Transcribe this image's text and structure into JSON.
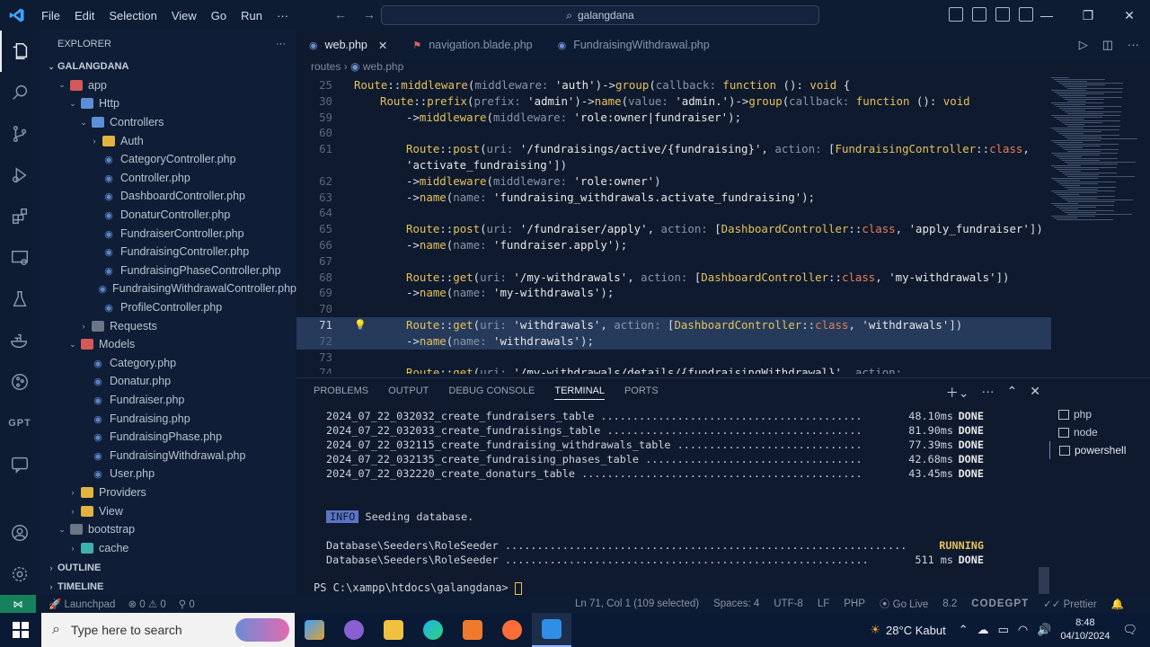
{
  "titlebar": {
    "menu": [
      "File",
      "Edit",
      "Selection",
      "View",
      "Go",
      "Run",
      "···"
    ],
    "search": "galangdana"
  },
  "explorer": {
    "title": "EXPLORER",
    "root": "GALANGDANA",
    "tree": [
      {
        "label": "app",
        "depth": 1,
        "open": true,
        "type": "folder-red"
      },
      {
        "label": "Http",
        "depth": 2,
        "open": true,
        "type": "folder"
      },
      {
        "label": "Controllers",
        "depth": 3,
        "open": true,
        "type": "folder"
      },
      {
        "label": "Auth",
        "depth": 4,
        "open": false,
        "type": "folder-yellow"
      },
      {
        "label": "CategoryController.php",
        "depth": 4,
        "type": "php"
      },
      {
        "label": "Controller.php",
        "depth": 4,
        "type": "php"
      },
      {
        "label": "DashboardController.php",
        "depth": 4,
        "type": "php"
      },
      {
        "label": "DonaturController.php",
        "depth": 4,
        "type": "php"
      },
      {
        "label": "FundraiserController.php",
        "depth": 4,
        "type": "php"
      },
      {
        "label": "FundraisingController.php",
        "depth": 4,
        "type": "php"
      },
      {
        "label": "FundraisingPhaseController.php",
        "depth": 4,
        "type": "php"
      },
      {
        "label": "FundraisingWithdrawalController.php",
        "depth": 4,
        "type": "php"
      },
      {
        "label": "ProfileController.php",
        "depth": 4,
        "type": "php"
      },
      {
        "label": "Requests",
        "depth": 3,
        "open": false,
        "type": "folder-gray"
      },
      {
        "label": "Models",
        "depth": 2,
        "open": true,
        "type": "folder-red"
      },
      {
        "label": "Category.php",
        "depth": 3,
        "type": "php"
      },
      {
        "label": "Donatur.php",
        "depth": 3,
        "type": "php"
      },
      {
        "label": "Fundraiser.php",
        "depth": 3,
        "type": "php"
      },
      {
        "label": "Fundraising.php",
        "depth": 3,
        "type": "php"
      },
      {
        "label": "FundraisingPhase.php",
        "depth": 3,
        "type": "php"
      },
      {
        "label": "FundraisingWithdrawal.php",
        "depth": 3,
        "type": "php"
      },
      {
        "label": "User.php",
        "depth": 3,
        "type": "php"
      },
      {
        "label": "Providers",
        "depth": 2,
        "open": false,
        "type": "folder-yellow"
      },
      {
        "label": "View",
        "depth": 2,
        "open": false,
        "type": "folder-yellow"
      },
      {
        "label": "bootstrap",
        "depth": 1,
        "open": true,
        "type": "folder-gray"
      },
      {
        "label": "cache",
        "depth": 2,
        "open": false,
        "type": "folder-teal"
      }
    ],
    "sections": [
      "OUTLINE",
      "TIMELINE"
    ]
  },
  "tabs": [
    {
      "label": "web.php",
      "active": true
    },
    {
      "label": "navigation.blade.php",
      "active": false
    },
    {
      "label": "FundraisingWithdrawal.php",
      "active": false
    }
  ],
  "breadcrumb": {
    "folder": "routes",
    "file": "web.php"
  },
  "code_lines": [
    {
      "n": "25",
      "t": "Route::middleware(middleware: 'auth')->group(callback: function (): void {",
      "indent": 0
    },
    {
      "n": "30",
      "t": "Route::prefix(prefix: 'admin')->name(value: 'admin.')->group(callback: function (): void",
      "indent": 1
    },
    {
      "n": "59",
      "t": "->middleware(middleware: 'role:owner|fundraiser');",
      "indent": 2
    },
    {
      "n": "60",
      "t": "",
      "indent": 2
    },
    {
      "n": "61",
      "t": "Route::post(uri: '/fundraisings/active/{fundraising}', action: [FundraisingController::class,",
      "indent": 2
    },
    {
      "n": "",
      "t": "'activate_fundraising'])",
      "indent": 2
    },
    {
      "n": "62",
      "t": "->middleware(middleware: 'role:owner')",
      "indent": 2
    },
    {
      "n": "63",
      "t": "->name(name: 'fundraising_withdrawals.activate_fundraising');",
      "indent": 2
    },
    {
      "n": "64",
      "t": "",
      "indent": 2
    },
    {
      "n": "65",
      "t": "Route::post(uri: '/fundraiser/apply', action: [DashboardController::class, 'apply_fundraiser'])",
      "indent": 2
    },
    {
      "n": "66",
      "t": "->name(name: 'fundraiser.apply');",
      "indent": 2
    },
    {
      "n": "67",
      "t": "",
      "indent": 2
    },
    {
      "n": "68",
      "t": "Route::get(uri: '/my-withdrawals', action: [DashboardController::class, 'my-withdrawals'])",
      "indent": 2
    },
    {
      "n": "69",
      "t": "->name(name: 'my-withdrawals');",
      "indent": 2
    },
    {
      "n": "70",
      "t": "",
      "indent": 2
    },
    {
      "n": "71",
      "t": "Route::get(uri: 'withdrawals', action: [DashboardController::class, 'withdrawals'])",
      "indent": 2
    },
    {
      "n": "72",
      "t": "->name(name: 'withdrawals');",
      "indent": 2
    },
    {
      "n": "73",
      "t": "",
      "indent": 2
    },
    {
      "n": "74",
      "t": "Route::get(uri: '/my-withdrawals/details/{fundraisingWithdrawal}', action:",
      "indent": 2
    }
  ],
  "panel": {
    "tabs": [
      "PROBLEMS",
      "OUTPUT",
      "DEBUG CONSOLE",
      "TERMINAL",
      "PORTS"
    ],
    "active_tab": "TERMINAL",
    "terminal": [
      {
        "text": "2024_07_22_032032_create_fundraisers_table ......................................... ",
        "dur": "48.10ms",
        "status": "DONE"
      },
      {
        "text": "2024_07_22_032033_create_fundraisings_table ........................................ ",
        "dur": "81.90ms",
        "status": "DONE"
      },
      {
        "text": "2024_07_22_032115_create_fundraising_withdrawals_table ............................. ",
        "dur": "77.39ms",
        "status": "DONE"
      },
      {
        "text": "2024_07_22_032135_create_fundraising_phases_table .................................. ",
        "dur": "42.68ms",
        "status": "DONE"
      },
      {
        "text": "2024_07_22_032220_create_donaturs_table ............................................ ",
        "dur": "43.45ms",
        "status": "DONE"
      }
    ],
    "info_badge": "INFO",
    "info_text": "Seeding database.",
    "seeder_running": {
      "text": "Database\\Seeders\\RoleSeeder ...............................................................",
      "status": "RUNNING"
    },
    "seeder_done": {
      "text": "Database\\Seeders\\RoleSeeder ......................................................... ",
      "dur": "511 ms",
      "status": "DONE"
    },
    "prompt": "PS C:\\xampp\\htdocs\\galangdana> ",
    "shells": [
      "php",
      "node",
      "powershell"
    ],
    "active_shell": "powershell"
  },
  "statusbar": {
    "launchpad": "Launchpad",
    "errors": "⊗ 0 ⚠ 0",
    "ports": "⚲ 0",
    "position": "Ln 71, Col 1 (109 selected)",
    "spaces": "Spaces: 4",
    "encoding": "UTF-8",
    "eol": "LF",
    "language": "PHP",
    "golive": "Go Live",
    "version": "8.2",
    "codegpt": "CODEGPT",
    "prettier": "Prettier"
  },
  "taskbar": {
    "search_placeholder": "Type here to search",
    "weather": "28°C  Kabut",
    "time": "8:48",
    "date": "04/10/2024"
  },
  "colors": {
    "accent": "#5c74c7",
    "status_remote": "#16825d"
  }
}
